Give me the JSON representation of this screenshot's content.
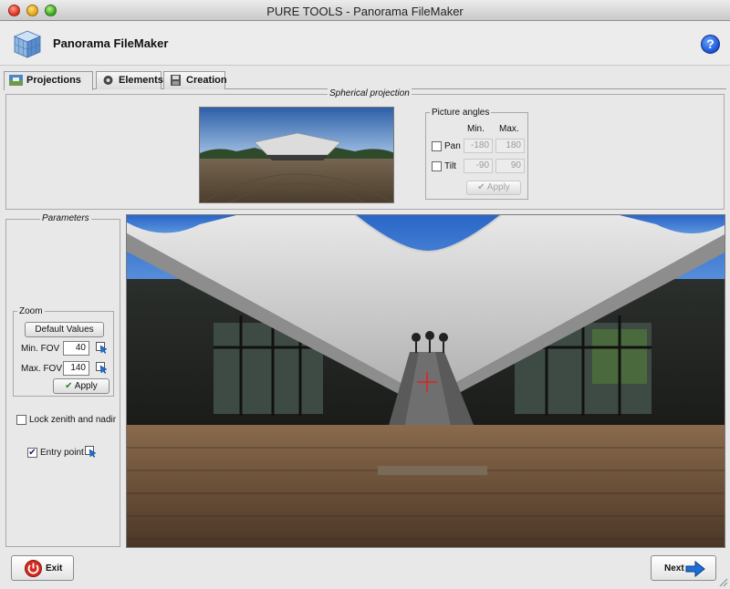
{
  "window": {
    "title": "PURE TOOLS - Panorama FileMaker"
  },
  "header": {
    "app_name": "Panorama FileMaker",
    "help_label": "?"
  },
  "tabs": [
    {
      "label": "Projections",
      "icon": "globe-icon",
      "active": true
    },
    {
      "label": "Elements",
      "icon": "gear-icon",
      "active": false
    },
    {
      "label": "Creation",
      "icon": "floppy-disk-icon",
      "active": false
    }
  ],
  "spherical": {
    "legend": "Spherical projection",
    "angles": {
      "legend": "Picture angles",
      "min_header": "Min.",
      "max_header": "Max.",
      "rows": [
        {
          "label": "Pan",
          "checked": false,
          "min": "-180",
          "max": "180"
        },
        {
          "label": "Tilt",
          "checked": false,
          "min": "-90",
          "max": "90"
        }
      ],
      "apply_label": "Apply"
    }
  },
  "parameters": {
    "legend": "Parameters",
    "zoom": {
      "legend": "Zoom",
      "default_values_label": "Default Values",
      "min_fov_label": "Min. FOV",
      "min_fov_value": "40",
      "max_fov_label": "Max. FOV",
      "max_fov_value": "140",
      "apply_label": "Apply"
    },
    "lock_zenith_label": "Lock zenith and nadir",
    "lock_zenith_checked": false,
    "entry_point_label": "Entry point",
    "entry_point_checked": true
  },
  "footer": {
    "exit_label": "Exit",
    "next_label": "Next"
  },
  "colors": {
    "accent_blue": "#1b6fd9",
    "exit_red": "#d32a1e",
    "crosshair_red": "#e02020"
  }
}
